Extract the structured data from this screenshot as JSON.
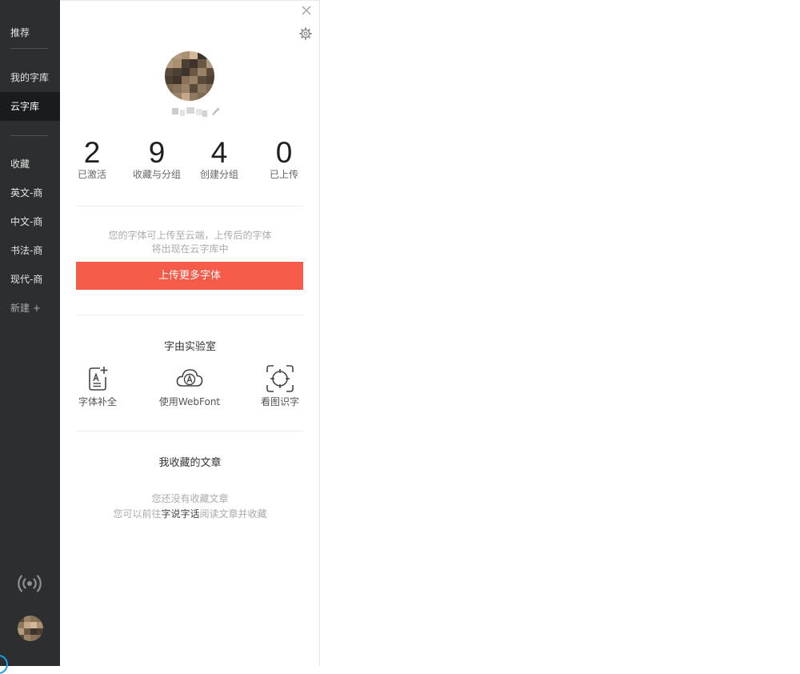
{
  "sidebar": {
    "top": "推荐",
    "items": [
      {
        "label": "我的字库"
      },
      {
        "label": "云字库",
        "active": true
      }
    ],
    "groups": [
      {
        "label": "收藏"
      },
      {
        "label": "英文-商"
      },
      {
        "label": "中文-商"
      },
      {
        "label": "书法-商"
      },
      {
        "label": "现代-商"
      }
    ],
    "new_label": "新建 +",
    "radio_icon": "radio-broadcast-icon"
  },
  "panel": {
    "close_icon": "close-icon",
    "settings_icon": "gear-icon",
    "stats": [
      {
        "value": "2",
        "label": "已激活"
      },
      {
        "value": "9",
        "label": "收藏与分组"
      },
      {
        "value": "4",
        "label": "创建分组"
      },
      {
        "value": "0",
        "label": "已上传"
      }
    ],
    "upload_note_line1": "您的字体可上传至云端，上传后的字体",
    "upload_note_line2": "将出现在云字库中",
    "upload_button": "上传更多字体",
    "lab_title": "字由实验室",
    "lab_items": [
      {
        "label": "字体补全",
        "icon": "font-completion-icon"
      },
      {
        "label": "使用WebFont",
        "icon": "cloud-webfont-icon"
      },
      {
        "label": "看图识字",
        "icon": "scan-recognize-icon"
      }
    ],
    "articles_title": "我收藏的文章",
    "empty_line1": "您还没有收藏文章",
    "empty_line2_prefix": "您可以前往",
    "empty_line2_link": "字说字话",
    "empty_line2_suffix": "阅读文章并收藏"
  },
  "colors": {
    "sidebar_bg": "#2c2e2f",
    "sidebar_active": "#1a1b1c",
    "accent": "#f45b49"
  }
}
